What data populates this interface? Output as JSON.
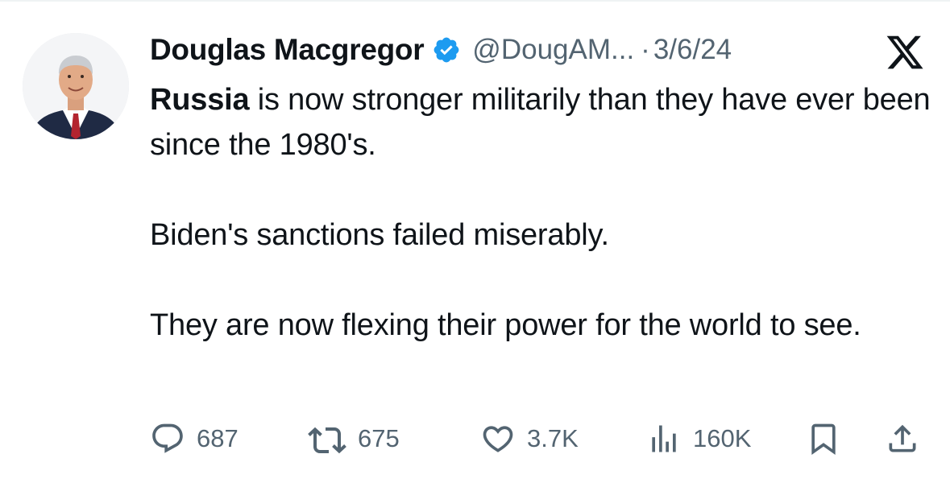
{
  "author": {
    "display_name": "Douglas Macgregor",
    "handle": "@DougAM...",
    "separator": "·",
    "date": "3/6/24",
    "verified": true
  },
  "tweet": {
    "mention_word": "Russia",
    "line1_rest": " is now stronger militarily than they have ever been since the 1980's.",
    "paragraph2": "Biden's sanctions failed miserably.",
    "paragraph3": "They are now flexing their power for the world to see."
  },
  "metrics": {
    "replies": "687",
    "retweets": "675",
    "likes": "3.7K",
    "views": "160K"
  },
  "icons": {
    "platform": "x-logo-icon",
    "verified": "verified-badge-icon",
    "reply": "reply-icon",
    "retweet": "retweet-icon",
    "like": "heart-icon",
    "views": "views-chart-icon",
    "bookmark": "bookmark-icon",
    "share": "share-icon"
  },
  "colors": {
    "text": "#0f1419",
    "secondary": "#536471",
    "verified": "#1d9bf0"
  }
}
